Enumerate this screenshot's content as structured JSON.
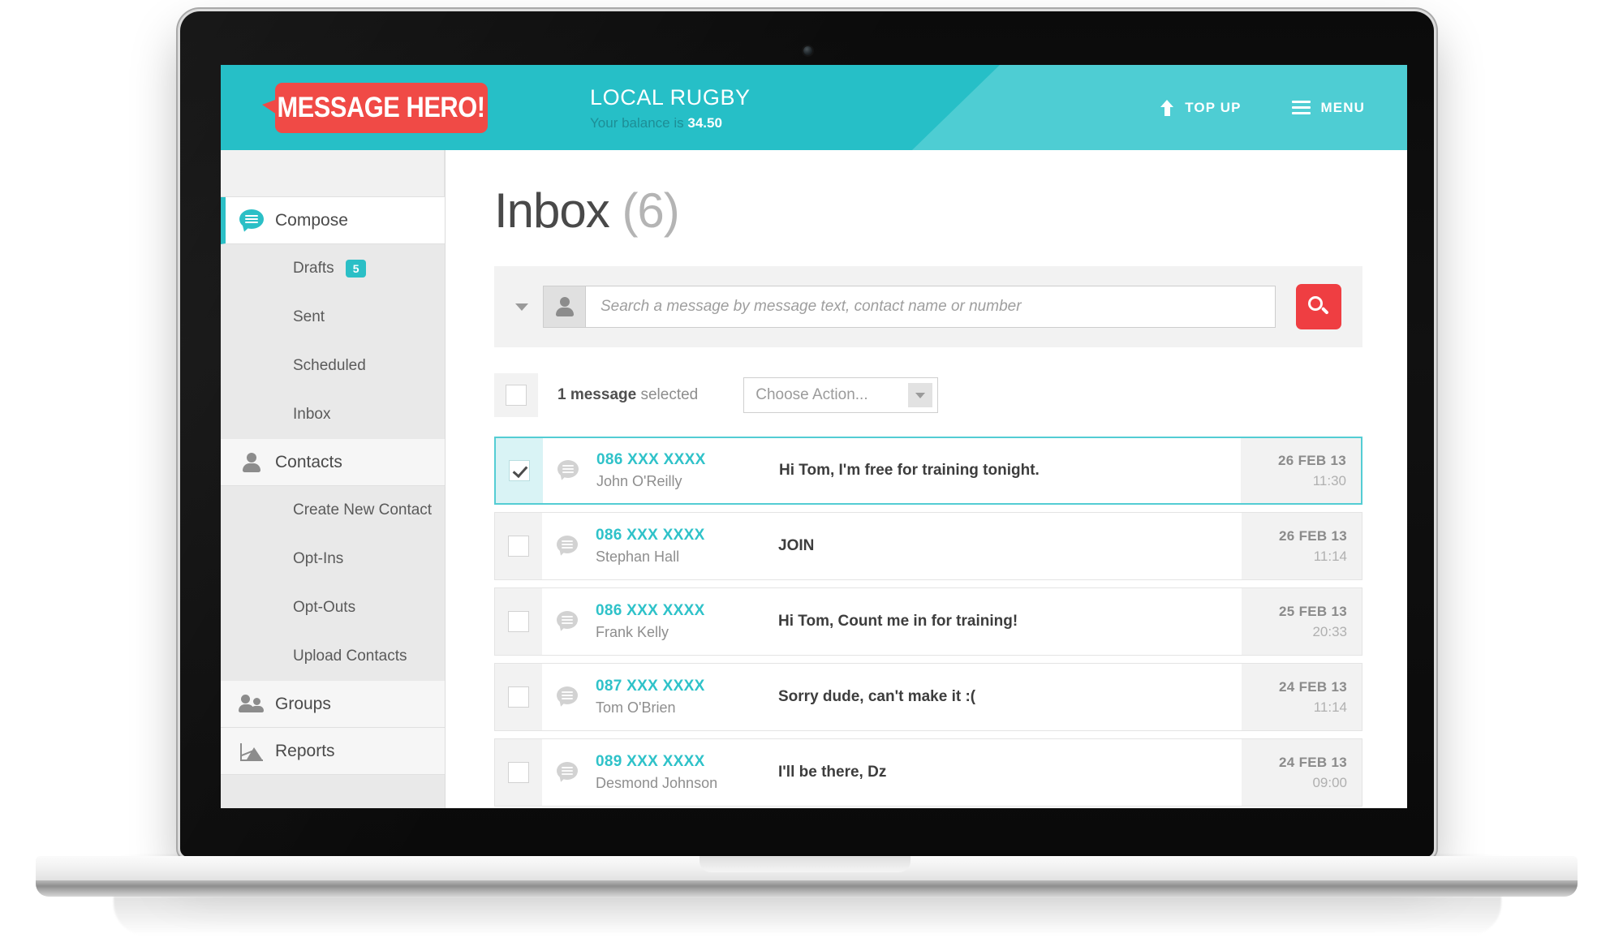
{
  "header": {
    "logo_text": "MESSAGE HERO!",
    "account_name": "LOCAL RUGBY",
    "balance_prefix": "Your balance is",
    "balance_value": "34.50",
    "top_up_label": "TOP UP",
    "menu_label": "MENU",
    "bg_color": "#26bfc7",
    "bg_color_light": "#4ecdd3",
    "logo_color": "#f04a46"
  },
  "sidebar": {
    "items": [
      {
        "label": "Compose",
        "icon": "compose-icon",
        "type": "main",
        "active": true
      },
      {
        "label": "Drafts",
        "type": "sub",
        "badge": "5"
      },
      {
        "label": "Sent",
        "type": "sub"
      },
      {
        "label": "Scheduled",
        "type": "sub"
      },
      {
        "label": "Inbox",
        "type": "sub"
      },
      {
        "label": "Contacts",
        "icon": "person-icon",
        "type": "main"
      },
      {
        "label": "Create New Contact",
        "type": "sub"
      },
      {
        "label": "Opt-Ins",
        "type": "sub"
      },
      {
        "label": "Opt-Outs",
        "type": "sub"
      },
      {
        "label": "Upload Contacts",
        "type": "sub"
      },
      {
        "label": "Groups",
        "icon": "group-icon",
        "type": "main"
      },
      {
        "label": "Reports",
        "icon": "report-icon",
        "type": "main"
      }
    ]
  },
  "main": {
    "title": "Inbox",
    "count": "(6)",
    "search": {
      "placeholder": "Search a message by message text, contact name or number",
      "value": "",
      "prefix_icon": "person-icon",
      "submit_icon": "search-icon",
      "submit_color": "#ef3e42"
    },
    "action_bar": {
      "selected_count": "1 message",
      "selected_suffix": "selected",
      "choose_action_label": "Choose Action..."
    },
    "messages": [
      {
        "number": "086 XXX XXXX",
        "name": "John O'Reilly",
        "text": "Hi Tom, I'm free for training tonight.",
        "date": "26 FEB 13",
        "time": "11:30",
        "selected": true
      },
      {
        "number": "086 XXX XXXX",
        "name": "Stephan Hall",
        "text": "JOIN",
        "date": "26 FEB 13",
        "time": "11:14",
        "selected": false
      },
      {
        "number": "086 XXX XXXX",
        "name": "Frank Kelly",
        "text": "Hi Tom, Count me in for training!",
        "date": "25 FEB 13",
        "time": "20:33",
        "selected": false
      },
      {
        "number": "087 XXX XXXX",
        "name": "Tom O'Brien",
        "text": "Sorry dude, can't make it :(",
        "date": "24 FEB 13",
        "time": "11:14",
        "selected": false
      },
      {
        "number": "089 XXX XXXX",
        "name": "Desmond Johnson",
        "text": "I'll be there, Dz",
        "date": "24 FEB 13",
        "time": "09:00",
        "selected": false
      },
      {
        "number": "",
        "name": "",
        "text": "",
        "date": "",
        "time": "",
        "selected": false
      }
    ]
  }
}
